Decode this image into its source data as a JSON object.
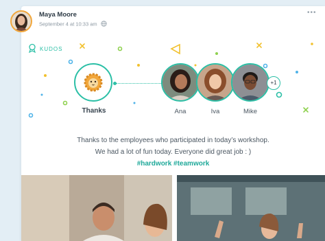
{
  "post": {
    "author": "Maya Moore",
    "timestamp": "September 4 at 10:33 am",
    "privacy_icon": "globe-icon",
    "more_label": "•••"
  },
  "kudos": {
    "label": "KUDOS",
    "badge_name": "Thanks",
    "recipients": [
      {
        "name": "Ana"
      },
      {
        "name": "Iva"
      },
      {
        "name": "Mike"
      }
    ],
    "more_count": "+1"
  },
  "message": {
    "line1": "Thanks to the employees who participated in today’s workshop.",
    "line2": "We had a lot of fun today. Everyone did great job : )",
    "hashtags": "#hardwork #teamwork"
  },
  "colors": {
    "accent": "#2bbfa6",
    "background": "#e3eef5",
    "avatar_ring": "#f2a73b",
    "confetti_yellow": "#f2c12e",
    "confetti_green": "#8fd14f",
    "confetti_blue": "#4fb3e8"
  }
}
